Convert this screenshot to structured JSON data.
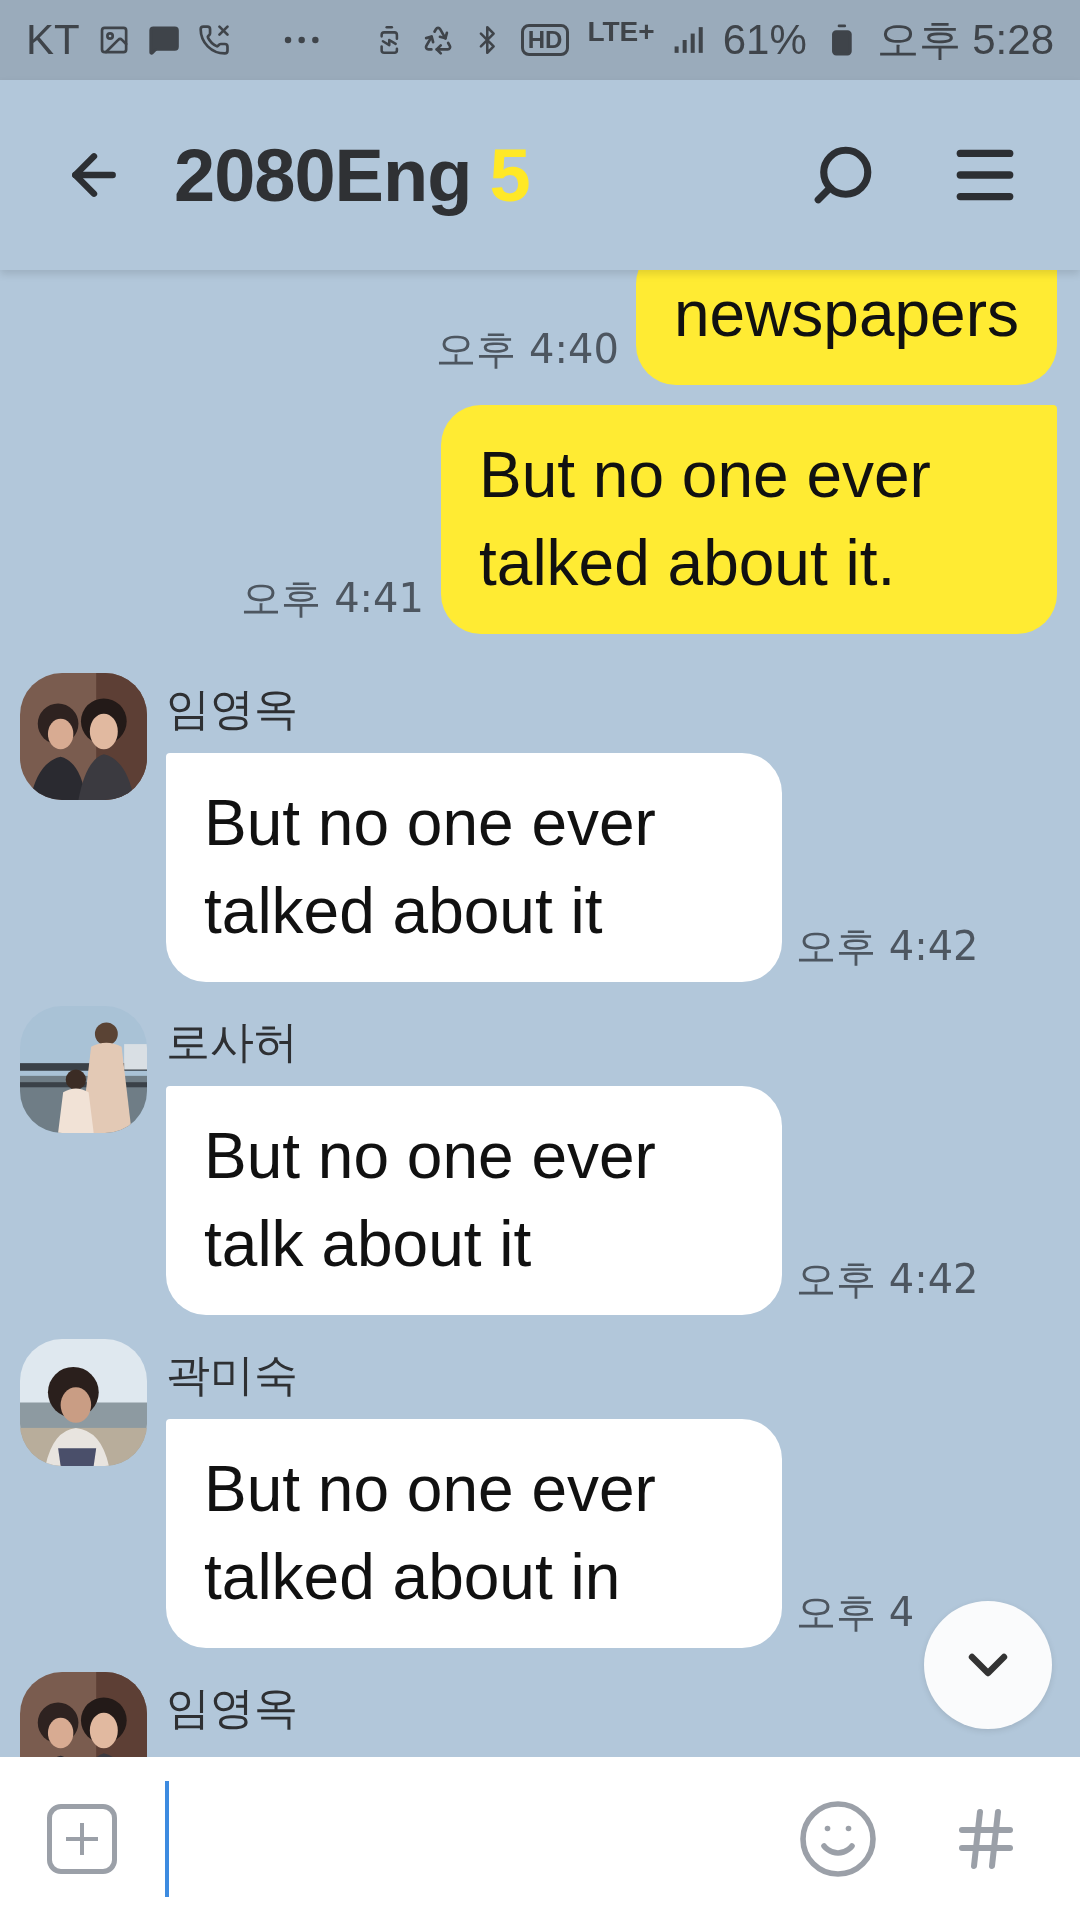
{
  "status_bar": {
    "carrier": "KT",
    "hd_badge": "HD",
    "network": "LTE+",
    "battery": "61%",
    "time": "오후 5:28"
  },
  "header": {
    "title": "2080Eng",
    "member_count": "5"
  },
  "messages": [
    {
      "kind": "sent",
      "text": "newspapers",
      "time": "오후 4:40"
    },
    {
      "kind": "sent",
      "text": "But no one ever talked about it.",
      "time": "오후 4:41"
    },
    {
      "kind": "received",
      "sender": "임영옥",
      "text": "But no one ever talked about it",
      "time": "오후 4:42"
    },
    {
      "kind": "received",
      "sender": "로사허",
      "text": "But no one ever talk about it",
      "time": "오후 4:42"
    },
    {
      "kind": "received",
      "sender": "곽미숙",
      "text": "But no one ever talked about in",
      "time": "오후 4"
    },
    {
      "kind": "received",
      "sender": "임영옥"
    }
  ],
  "composer": {
    "focused": true
  }
}
